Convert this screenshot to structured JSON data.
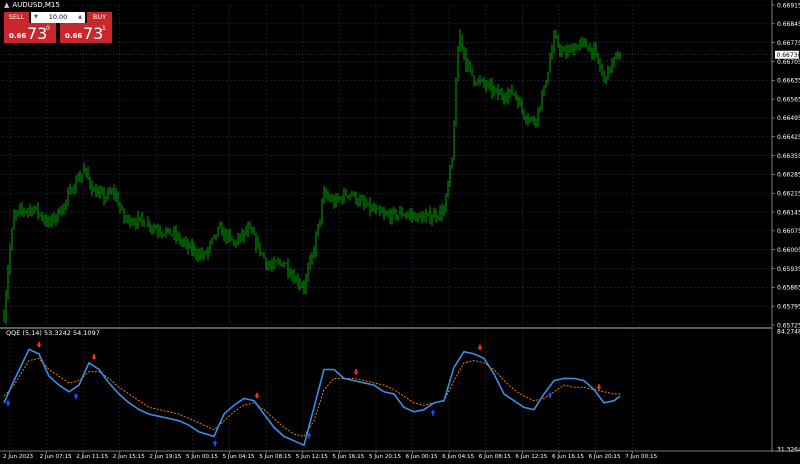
{
  "symbol": "AUDUSD,M15",
  "indicator_label": "QQE (5,14) 53.3242 54.1097",
  "one_click": {
    "sell_label": "SELL",
    "buy_label": "BUY",
    "lot": "10.00",
    "sell_small": "0.66",
    "sell_big": "73",
    "sell_sup": "0",
    "buy_small": "0.66",
    "buy_big": "73",
    "buy_sup": "1"
  },
  "colors": {
    "background": "#000000",
    "candle": "#00d400",
    "qqe_line": "#3c8ee6",
    "qqe_signal": "#ff8c00",
    "arrow_up": "#1e4cff",
    "arrow_down": "#ff2a1a",
    "grid": "#2b2b45",
    "separator": "#7a7a7a",
    "current_price_box": "#ffffff"
  },
  "chart_data": [
    {
      "type": "candlestick",
      "title": "AUDUSD,M15",
      "y_ticks": [
        "0.66915",
        "0.66845",
        "0.66775",
        "0.66705",
        "0.66635",
        "0.66565",
        "0.66495",
        "0.66425",
        "0.66355",
        "0.66285",
        "0.66215",
        "0.66145",
        "0.66075",
        "0.66005",
        "0.65935",
        "0.65865",
        "0.65795",
        "0.65725"
      ],
      "ylim": [
        0.65725,
        0.66915
      ],
      "current_price": "0.66730",
      "grid": true,
      "anchors": [
        [
          0,
          0.6576
        ],
        [
          5,
          0.6598
        ],
        [
          10,
          0.6613
        ],
        [
          18,
          0.6615
        ],
        [
          30,
          0.6616
        ],
        [
          45,
          0.661
        ],
        [
          60,
          0.6617
        ],
        [
          70,
          0.6625
        ],
        [
          80,
          0.663
        ],
        [
          90,
          0.6622
        ],
        [
          100,
          0.662
        ],
        [
          110,
          0.6622
        ],
        [
          120,
          0.6612
        ],
        [
          140,
          0.6611
        ],
        [
          155,
          0.6608
        ],
        [
          170,
          0.6606
        ],
        [
          185,
          0.6601
        ],
        [
          200,
          0.6598
        ],
        [
          215,
          0.6608
        ],
        [
          230,
          0.6603
        ],
        [
          245,
          0.6608
        ],
        [
          255,
          0.6601
        ],
        [
          265,
          0.6594
        ],
        [
          280,
          0.6596
        ],
        [
          290,
          0.659
        ],
        [
          300,
          0.6587
        ],
        [
          310,
          0.6601
        ],
        [
          320,
          0.6621
        ],
        [
          330,
          0.6618
        ],
        [
          345,
          0.6622
        ],
        [
          360,
          0.6617
        ],
        [
          380,
          0.6613
        ],
        [
          400,
          0.6614
        ],
        [
          420,
          0.6612
        ],
        [
          440,
          0.6615
        ],
        [
          448,
          0.6634
        ],
        [
          455,
          0.6682
        ],
        [
          462,
          0.667
        ],
        [
          470,
          0.6664
        ],
        [
          480,
          0.6662
        ],
        [
          495,
          0.6658
        ],
        [
          510,
          0.6659
        ],
        [
          520,
          0.6651
        ],
        [
          530,
          0.6648
        ],
        [
          540,
          0.666
        ],
        [
          550,
          0.6679
        ],
        [
          560,
          0.6673
        ],
        [
          570,
          0.6676
        ],
        [
          580,
          0.6677
        ],
        [
          590,
          0.6674
        ],
        [
          600,
          0.6664
        ],
        [
          610,
          0.6671
        ],
        [
          616,
          0.6673
        ]
      ]
    },
    {
      "type": "line",
      "title": "QQE (5,14) 53.3242 54.1097",
      "y_ticks": [
        "84.2748",
        "31.3264"
      ],
      "ylim": [
        31.3264,
        84.2748
      ],
      "series": [
        {
          "name": "53.3242",
          "x": [
            0,
            10,
            25,
            35,
            45,
            55,
            65,
            75,
            85,
            95,
            105,
            115,
            125,
            135,
            145,
            155,
            165,
            175,
            185,
            195,
            210,
            220,
            230,
            240,
            250,
            260,
            270,
            280,
            290,
            300,
            310,
            320,
            330,
            340,
            350,
            360,
            370,
            380,
            390,
            400,
            410,
            420,
            430,
            440,
            450,
            460,
            470,
            480,
            490,
            500,
            510,
            520,
            530,
            540,
            550,
            560,
            570,
            580,
            590,
            600,
            610,
            616
          ],
          "values": [
            52,
            62,
            76,
            74,
            64,
            60,
            57,
            60,
            70,
            67,
            61,
            56,
            52,
            49,
            47,
            46,
            45,
            44,
            42,
            39,
            37,
            47,
            51,
            54,
            53,
            47,
            41,
            37,
            35,
            33,
            50,
            67,
            67,
            63,
            62,
            61,
            60,
            57,
            56,
            50,
            48,
            49,
            52,
            53,
            68,
            75,
            74,
            72,
            65,
            56,
            53,
            50,
            49,
            56,
            62,
            63,
            63,
            62,
            58,
            52,
            53,
            55
          ]
        },
        {
          "name": "54.1097",
          "x": [
            0,
            10,
            25,
            35,
            45,
            55,
            65,
            75,
            85,
            95,
            105,
            115,
            125,
            135,
            145,
            155,
            165,
            175,
            185,
            195,
            210,
            220,
            230,
            240,
            250,
            260,
            270,
            280,
            290,
            300,
            310,
            320,
            330,
            340,
            350,
            360,
            370,
            380,
            390,
            400,
            410,
            420,
            430,
            440,
            450,
            460,
            470,
            480,
            490,
            500,
            510,
            520,
            530,
            540,
            550,
            560,
            570,
            580,
            590,
            600,
            610,
            616
          ],
          "values": [
            55,
            60,
            71,
            72,
            67,
            64,
            61,
            62,
            66,
            66,
            63,
            59,
            56,
            53,
            50,
            49,
            48,
            47,
            45,
            43,
            40,
            44,
            48,
            51,
            52,
            49,
            45,
            41,
            38,
            37,
            44,
            58,
            63,
            63,
            63,
            62,
            61,
            60,
            58,
            55,
            52,
            51,
            52,
            53,
            62,
            70,
            71,
            70,
            67,
            62,
            58,
            55,
            53,
            54,
            57,
            60,
            59,
            59,
            58,
            57,
            56,
            56
          ]
        }
      ],
      "arrows_up_x": [
        4,
        72,
        211,
        305,
        429,
        546
      ],
      "arrows_down_x": [
        35,
        90,
        253,
        352,
        476,
        595
      ]
    }
  ],
  "time_labels": [
    "2 Jun 2023",
    "2 Jun 07:15",
    "2 Jun 11:15",
    "2 Jun 15:15",
    "2 Jun 19:15",
    "5 Jun 00:15",
    "5 Jun 04:15",
    "5 Jun 08:15",
    "5 Jun 12:15",
    "5 Jun 16:15",
    "5 Jun 20:15",
    "6 Jun 00:15",
    "6 Jun 04:15",
    "6 Jun 08:15",
    "6 Jun 12:15",
    "6 Jun 16:15",
    "6 Jun 20:15",
    "7 Jun 00:15"
  ]
}
